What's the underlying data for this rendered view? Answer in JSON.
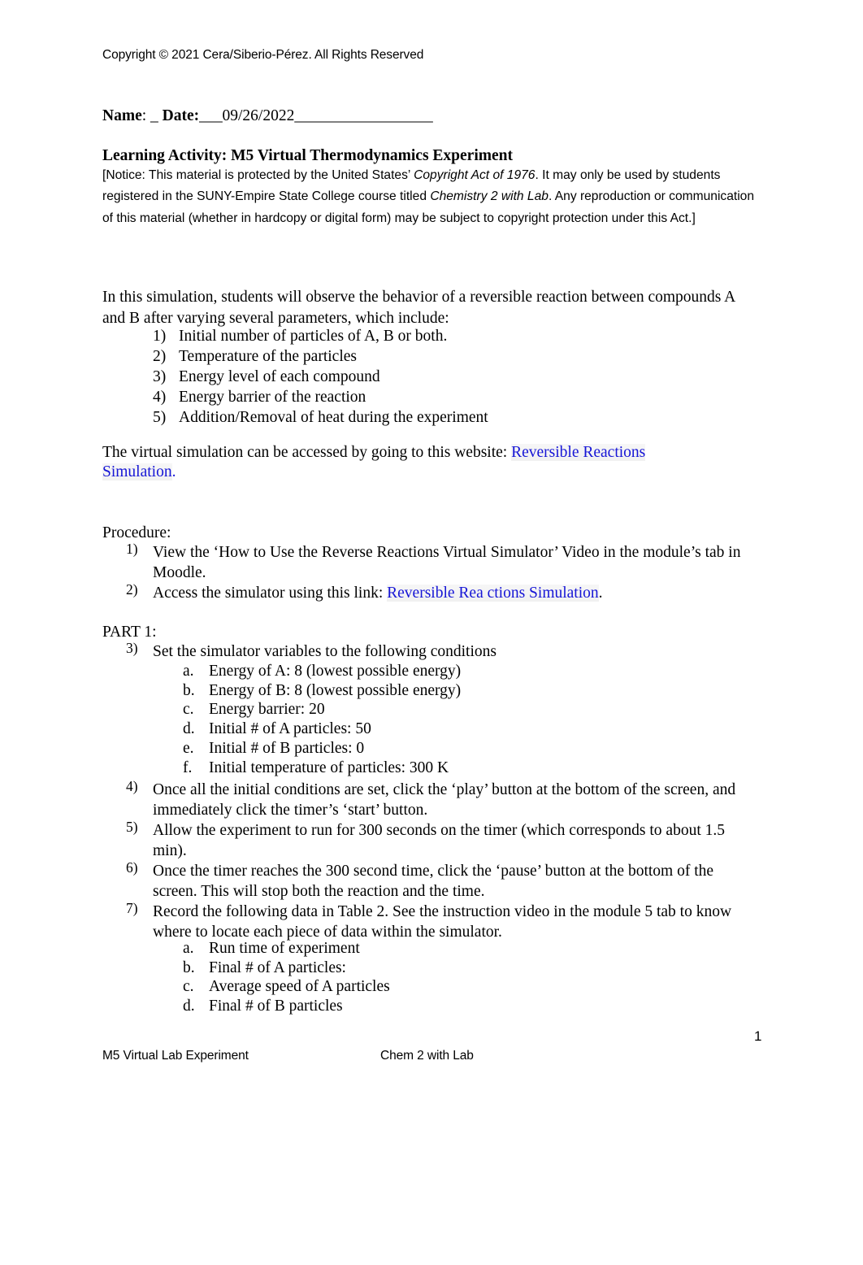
{
  "document": {
    "copyright_line": "Copyright © 2021 Cera/Siberio-Pérez. All Rights Reserved",
    "name_label": "Name",
    "name_separator": ": _ ",
    "date_label": "Date:",
    "date_prefix_rule": "___",
    "date_value": "09/26/2022",
    "date_suffix_rule": "__________________",
    "activity_title": "Learning Activity: M5 Virtual Thermodynamics Experiment",
    "page_number": "1"
  },
  "notice": {
    "part1": "[Notice: This material is protected by the United States’ ",
    "italic1": "Copyright Act of 1976",
    "part2": ". It may only be used by students registered in the SUNY-Empire State College course titled ",
    "italic2": "Chemistry 2 with Lab",
    "part3": ". Any reproduction or communication of this material (whether in hardcopy or digital form) may be subject to copyright protection under this Act.]"
  },
  "intro": {
    "paragraph": "In this simulation, students will observe the behavior of a reversible reaction between compounds A and B after varying several parameters, which include:",
    "parameters": [
      {
        "marker": "1)",
        "text": "Initial number of particles of A, B or both."
      },
      {
        "marker": "2)",
        "text": "Temperature of the particles"
      },
      {
        "marker": "3)",
        "text": "Energy level of each compound"
      },
      {
        "marker": "4)",
        "text": "Energy barrier of the reaction"
      },
      {
        "marker": "5)",
        "text": "Addition/Removal of heat during the experiment"
      }
    ]
  },
  "website": {
    "lead_text": "The virtual simulation can be accessed by going to this website: ",
    "link_text": "Reversible Reactions Simulation",
    "trailing": "."
  },
  "procedure": {
    "label": "Procedure:",
    "steps": [
      {
        "marker": "1)",
        "text": "View the ‘How to Use the Reverse Reactions Virtual Simulator’ Video in the module’s tab in Moodle."
      },
      {
        "marker": "2)",
        "lead_text": "Access the simulator using this link: ",
        "link_text": "Reversible Rea ctions Simulation",
        "trailing": "."
      }
    ]
  },
  "part1": {
    "label": "PART 1:",
    "steps": [
      {
        "marker": "3)",
        "text": "Set the simulator variables to the following conditions"
      },
      {
        "marker": "4)",
        "text": "Once all the initial conditions are set, click the ‘play’ button at the bottom of the screen, and immediately click the timer’s ‘start’ button."
      },
      {
        "marker": "5)",
        "text": "Allow the experiment to run for 300 seconds on the timer (which corresponds to about 1.5 min)."
      },
      {
        "marker": "6)",
        "text": "Once the timer reaches the 300 second time, click the ‘pause’ button at the bottom of the screen. This will stop both the reaction and the time."
      },
      {
        "marker": "7)",
        "text": "Record the following data in Table 2. See the instruction video in the module 5 tab to know where to locate each piece of data within the simulator."
      }
    ],
    "conditions": [
      {
        "marker": "a.",
        "text": "Energy of A: 8 (lowest possible energy)"
      },
      {
        "marker": "b.",
        "text": "Energy of B: 8 (lowest possible energy)"
      },
      {
        "marker": "c.",
        "text": "Energy barrier: 20"
      },
      {
        "marker": "d.",
        "text": "Initial # of A particles: 50"
      },
      {
        "marker": "e.",
        "text": "Initial # of B particles: 0"
      },
      {
        "marker": "f.",
        "text": "Initial temperature of particles: 300 K"
      }
    ],
    "record_items": [
      {
        "marker": "a.",
        "text": "Run time of experiment"
      },
      {
        "marker": "b.",
        "text": "Final # of A particles:"
      },
      {
        "marker": "c.",
        "text": "Average speed of A particles"
      },
      {
        "marker": "d.",
        "text": "Final # of B particles"
      }
    ]
  },
  "footer": {
    "left": "M5 Virtual Lab Experiment",
    "center": "Chem 2 with Lab"
  },
  "colors": {
    "link": "#1615d6",
    "text": "#000000",
    "background": "#ffffff"
  }
}
